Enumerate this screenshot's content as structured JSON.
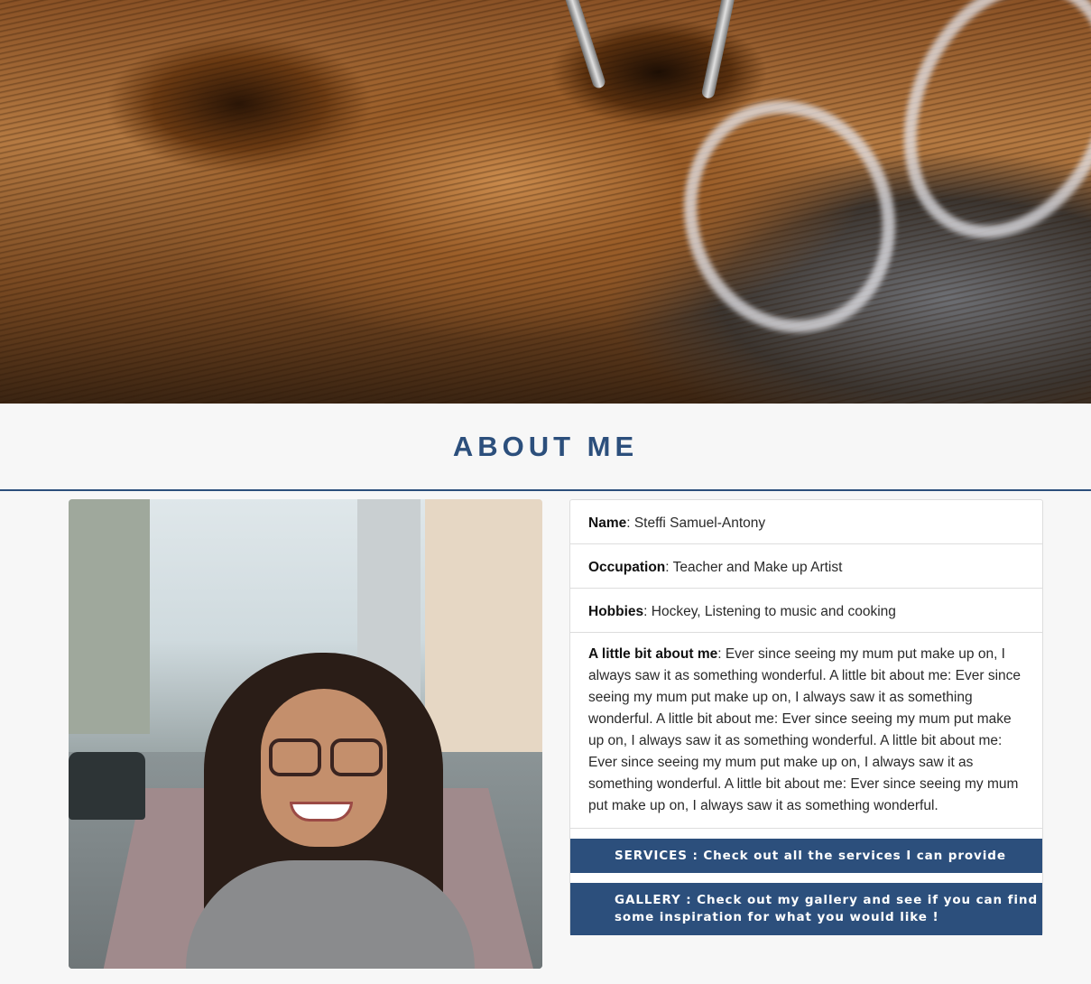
{
  "hero": {
    "image": "wooden-tool-with-metal-rings-photo"
  },
  "section": {
    "title": "ABOUT ME"
  },
  "profile": {
    "photo": "smiling-woman-with-glasses-city-street-photo",
    "name_label": "Name",
    "name_value": ": Steffi Samuel-Antony",
    "occupation_label": "Occupation",
    "occupation_value": ": Teacher and Make up Artist",
    "hobbies_label": "Hobbies",
    "hobbies_value": ": Hockey, Listening to music and cooking",
    "about_label": "A little bit about me",
    "about_value": ": Ever since seeing my mum put make up on, I always saw it as something wonderful. A little bit about me: Ever since seeing my mum put make up on, I always saw it as something wonderful. A little bit about me: Ever since seeing my mum put make up on, I always saw it as something wonderful. A little bit about me: Ever since seeing my mum put make up on, I always saw it as something wonderful. A little bit about me: Ever since seeing my mum put make up on, I always saw it as something wonderful."
  },
  "buttons": {
    "services_label": "SERVICES : Check out all the services I can provide",
    "gallery_label": "GALLERY : Check out my gallery and see if you can find some inspiration for what you would like !"
  },
  "colors": {
    "accent": "#2c4f7c",
    "background": "#f7f7f7"
  }
}
